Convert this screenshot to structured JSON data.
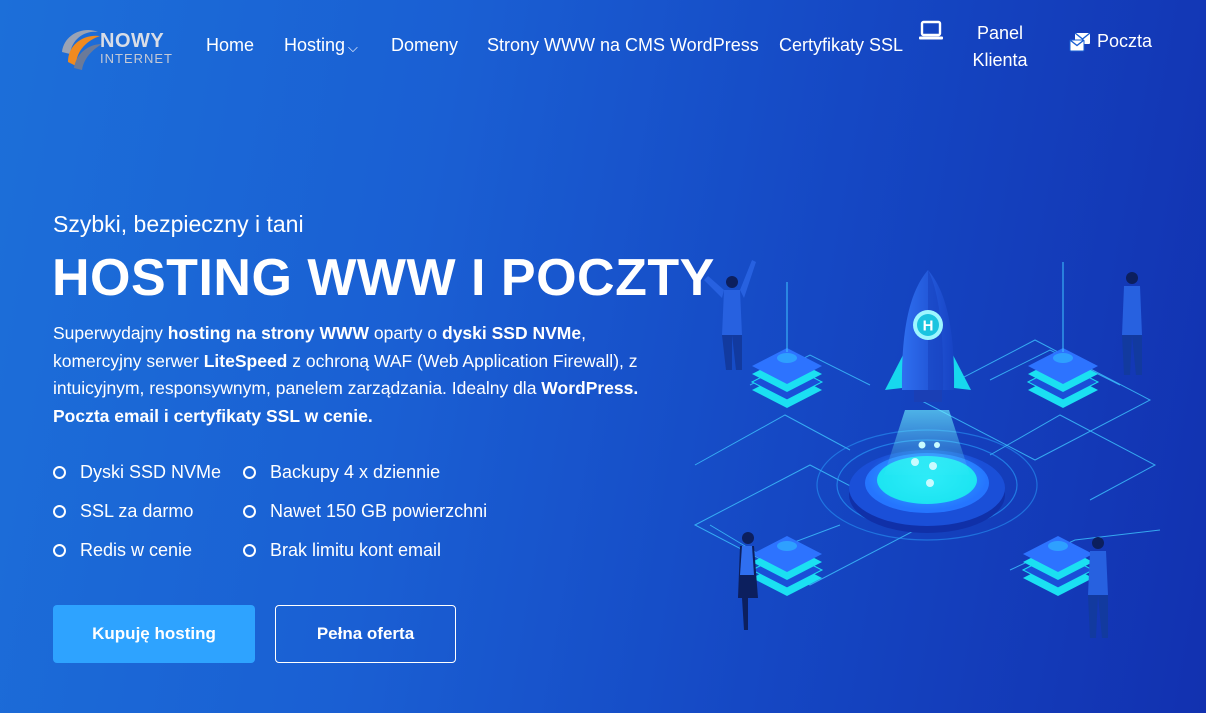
{
  "brand": {
    "line1": "NOWY",
    "line2": "INTERNET",
    "colors": {
      "accent_button": "#2ea3ff",
      "bg_start": "#1c6fd9",
      "bg_end": "#1231b0",
      "glow": "#19e3f0"
    }
  },
  "nav": {
    "home": "Home",
    "hosting": "Hosting",
    "domeny": "Domeny",
    "strony": "Strony WWW na CMS WordPress",
    "ssl": "Certyfikaty SSL",
    "panel_line1": "Panel",
    "panel_line2": "Klienta",
    "poczta": "Poczta",
    "icons": {
      "panel": "laptop-icon",
      "poczta": "mail-icon",
      "hosting_dropdown": "chevron-down-icon"
    }
  },
  "hero": {
    "subtitle": "Szybki, bezpieczny i tani",
    "title": "HOSTING WWW I POCZTY",
    "desc": {
      "p1": "Superwydajny ",
      "b1": "hosting na strony WWW",
      "p2": " oparty o ",
      "b2": "dyski SSD NVMe",
      "p3": ", komercyjny serwer ",
      "b3": "LiteSpeed",
      "p4": " z ochroną WAF (Web Application Firewall), z intuicyjnym, responsywnym, panelem zarządzania. Idealny dla ",
      "b4": "WordPress.",
      "p5": " ",
      "b5": "Poczta email i certyfikaty SSL w cenie."
    }
  },
  "features": {
    "col1": [
      "Dyski SSD NVMe",
      "SSL za darmo",
      "Redis w cenie"
    ],
    "col2": [
      "Backupy 4 x dziennie",
      "Nawet 150 GB powierzchni",
      "Brak limitu kont email"
    ]
  },
  "buttons": {
    "primary": "Kupuję hosting",
    "secondary": "Pełna oferta"
  },
  "illustration": {
    "rocket_badge": "H"
  }
}
